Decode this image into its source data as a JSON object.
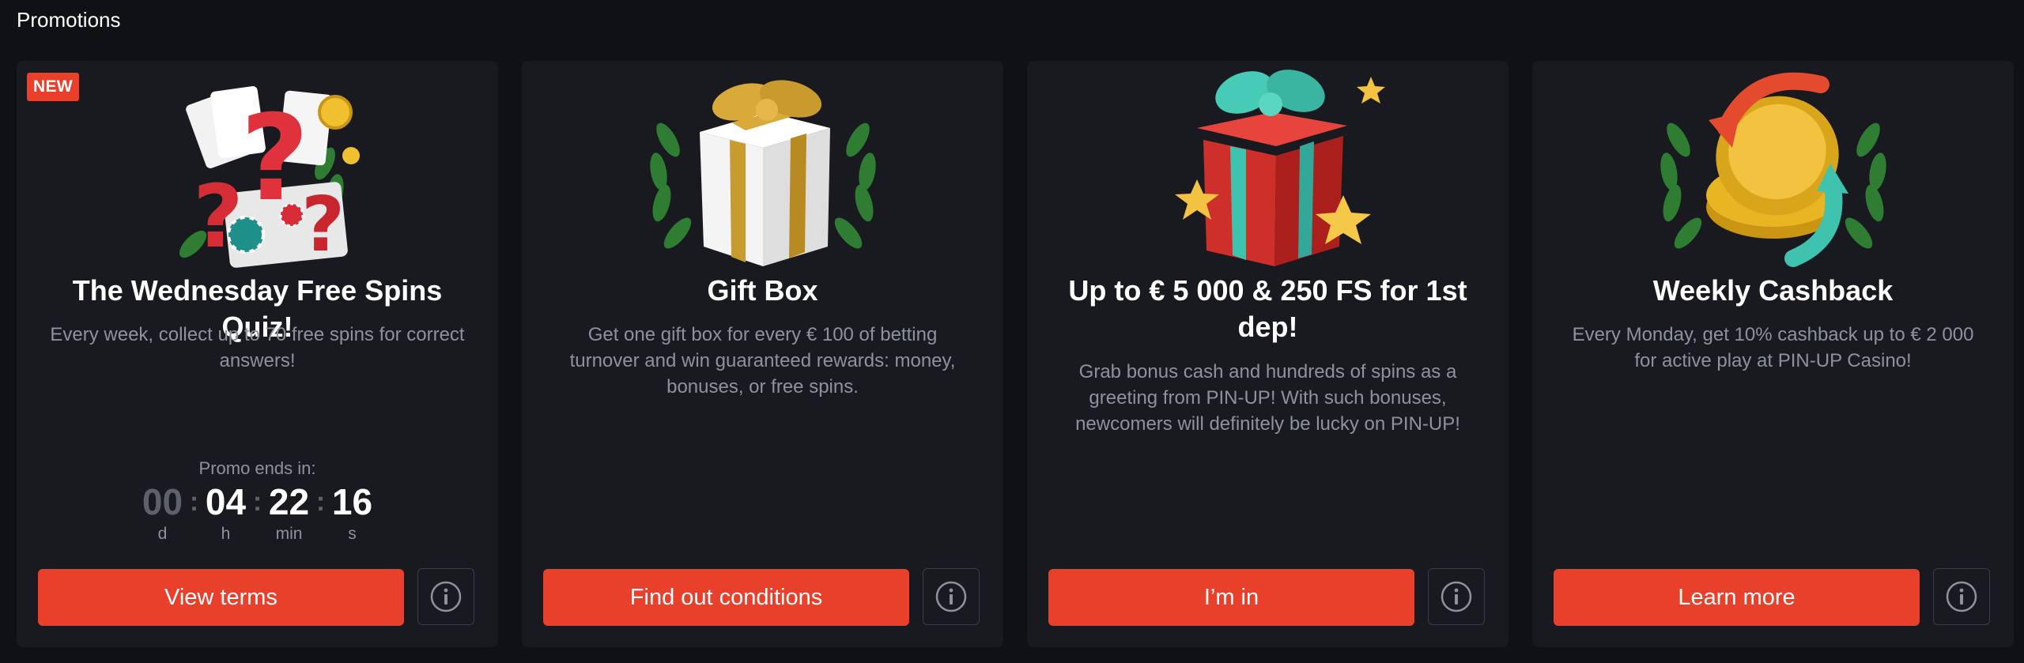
{
  "section": {
    "title": "Promotions"
  },
  "colors": {
    "background": "#101114",
    "card": "#181a1f",
    "accent": "#e8402a",
    "muted_text": "#8e929b"
  },
  "cards": [
    {
      "badge": "NEW",
      "art_icon": "question-marks-cards-icon",
      "title": "The Wednesday Free Spins Quiz!",
      "description": "Every week, collect up to 70 free spins for correct answers!",
      "timer": {
        "label": "Promo ends in:",
        "days": "00",
        "days_label": "d",
        "hours": "04",
        "hours_label": "h",
        "minutes": "22",
        "minutes_label": "min",
        "seconds": "16",
        "seconds_label": "s"
      },
      "button_label": "View terms",
      "info_icon": "info-icon"
    },
    {
      "art_icon": "white-gift-box-icon",
      "title": "Gift Box",
      "description": "Get one gift box for every € 100 of betting turnover and win guaranteed rewards: money, bonuses, or free spins.",
      "button_label": "Find out conditions",
      "info_icon": "info-icon"
    },
    {
      "art_icon": "red-gift-stars-icon",
      "title": "Up to € 5 000 & 250 FS for 1st dep!",
      "description": "Grab bonus cash and hundreds of spins as a greeting from PIN-UP! With such bonuses, newcomers will definitely be lucky on PIN-UP!",
      "button_label": "I’m in",
      "info_icon": "info-icon"
    },
    {
      "art_icon": "cashback-coin-icon",
      "title": "Weekly Cashback",
      "description": "Every Monday, get 10% cashback up to € 2 000 for active play at PIN-UP Casino!",
      "button_label": "Learn more",
      "info_icon": "info-icon"
    }
  ]
}
